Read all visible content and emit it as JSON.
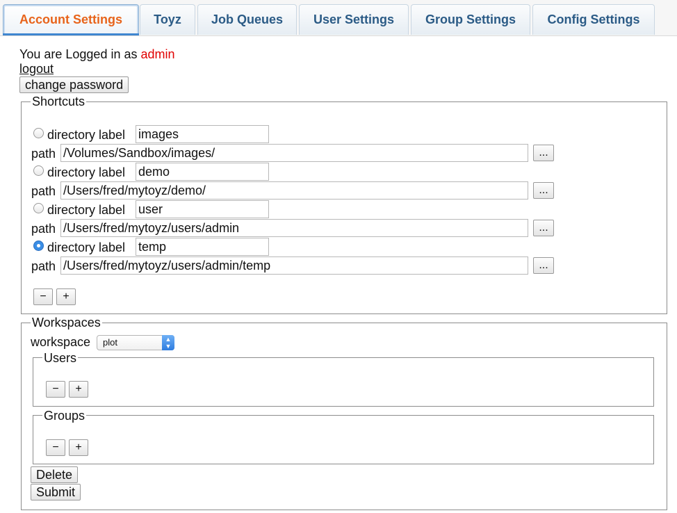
{
  "tabs": [
    {
      "label": "Account Settings",
      "active": true
    },
    {
      "label": "Toyz"
    },
    {
      "label": "Job Queues"
    },
    {
      "label": "User Settings"
    },
    {
      "label": "Group Settings"
    },
    {
      "label": "Config Settings"
    }
  ],
  "account": {
    "logged_in_prefix": "You are Logged in as",
    "username": "admin",
    "logout_label": "logout",
    "change_password_label": "change password"
  },
  "shortcuts": {
    "legend": "Shortcuts",
    "directory_label_text": "directory label",
    "path_text": "path",
    "browse_label": "...",
    "items": [
      {
        "label": "images",
        "path": "/Volumes/Sandbox/images/",
        "selected": false
      },
      {
        "label": "demo",
        "path": "/Users/fred/mytoyz/demo/",
        "selected": false
      },
      {
        "label": "user",
        "path": "/Users/fred/mytoyz/users/admin",
        "selected": false
      },
      {
        "label": "temp",
        "path": "/Users/fred/mytoyz/users/admin/temp",
        "selected": true
      }
    ],
    "minus_label": "−",
    "plus_label": "+"
  },
  "workspaces": {
    "legend": "Workspaces",
    "workspace_label": "workspace",
    "workspace_value": "plot",
    "users_legend": "Users",
    "groups_legend": "Groups",
    "minus_label": "−",
    "plus_label": "+",
    "delete_label": "Delete",
    "submit_label": "Submit"
  },
  "colors": {
    "active_tab_text": "#e8641b",
    "tab_text": "#2b5b86",
    "username": "#e00000",
    "radio_checked": "#3a8ee6"
  }
}
